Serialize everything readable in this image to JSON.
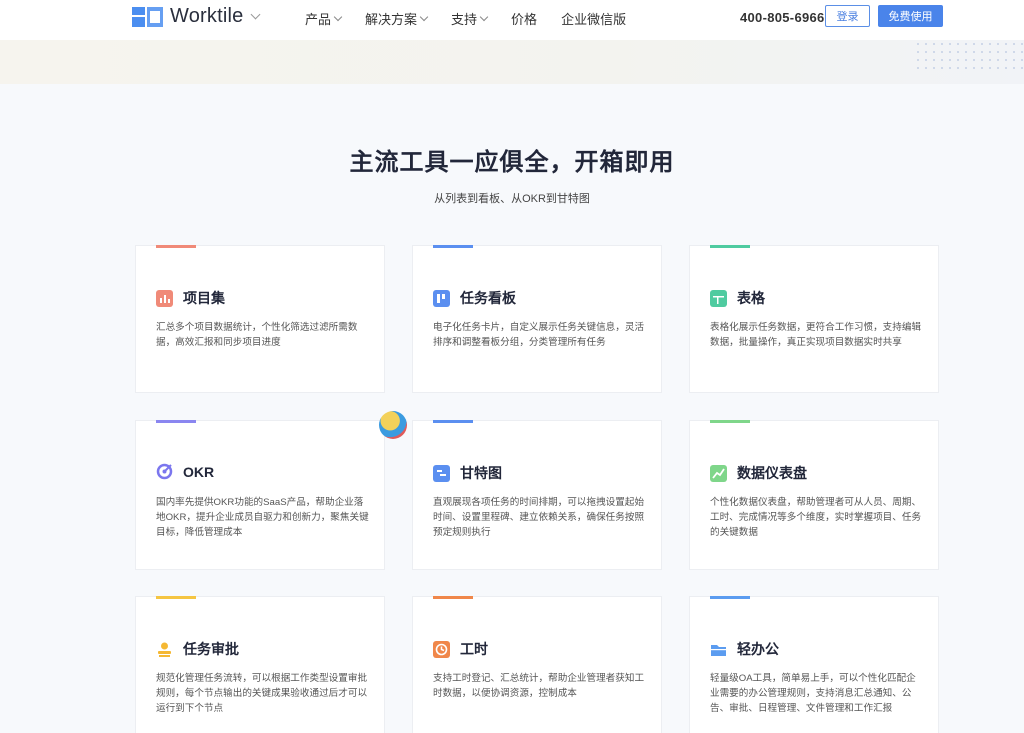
{
  "brand": {
    "name": "Worktile"
  },
  "nav": [
    {
      "label": "产品",
      "has_dropdown": true
    },
    {
      "label": "解决方案",
      "has_dropdown": true
    },
    {
      "label": "支持",
      "has_dropdown": true
    },
    {
      "label": "价格",
      "has_dropdown": false
    },
    {
      "label": "企业微信版",
      "has_dropdown": false
    }
  ],
  "header": {
    "phone": "400-805-6966",
    "login_label": "登录",
    "free_label": "免费使用"
  },
  "section": {
    "title": "主流工具一应俱全，开箱即用",
    "subtitle": "从列表到看板、从OKR到甘特图"
  },
  "cards": [
    {
      "title": "项目集",
      "desc": "汇总多个项目数据统计，个性化筛选过滤所需数据，高效汇报和同步项目进度",
      "accent": "#f08a78",
      "icon": "project-set-icon"
    },
    {
      "title": "任务看板",
      "desc": "电子化任务卡片，自定义展示任务关键信息，灵活排序和调整看板分组，分类管理所有任务",
      "accent": "#5b8ff0",
      "icon": "kanban-icon"
    },
    {
      "title": "表格",
      "desc": "表格化展示任务数据，更符合工作习惯，支持编辑数据，批量操作，真正实现项目数据实时共享",
      "accent": "#4fcba0",
      "icon": "table-icon"
    },
    {
      "title": "OKR",
      "desc": "国内率先提供OKR功能的SaaS产品，帮助企业落地OKR，提升企业成员自驱力和创新力，聚焦关键目标，降低管理成本",
      "accent": "#8a86f0",
      "icon": "okr-icon"
    },
    {
      "title": "甘特图",
      "desc": "直观展现各项任务的时间排期，可以拖拽设置起始时间、设置里程碑、建立依赖关系，确保任务按照预定规则执行",
      "accent": "#5b8ff0",
      "icon": "gantt-icon"
    },
    {
      "title": "数据仪表盘",
      "desc": "个性化数据仪表盘，帮助管理者可从人员、周期、工时、完成情况等多个维度，实时掌握项目、任务的关键数据",
      "accent": "#7fd68a",
      "icon": "dashboard-icon"
    },
    {
      "title": "任务审批",
      "desc": "规范化管理任务流转，可以根据工作类型设置审批规则，每个节点输出的关键成果验收通过后才可以运行到下个节点",
      "accent": "#f5c542",
      "icon": "approval-icon"
    },
    {
      "title": "工时",
      "desc": "支持工时登记、汇总统计，帮助企业管理者获知工时数据，以便协调资源，控制成本",
      "accent": "#f0874a",
      "icon": "clock-icon"
    },
    {
      "title": "轻办公",
      "desc": "轻量级OA工具，简单易上手，可以个性化匹配企业需要的办公管理规则，支持消息汇总通知、公告、审批、日程管理、文件管理和工作汇报",
      "accent": "#5b9cf0",
      "icon": "folder-icon"
    }
  ]
}
